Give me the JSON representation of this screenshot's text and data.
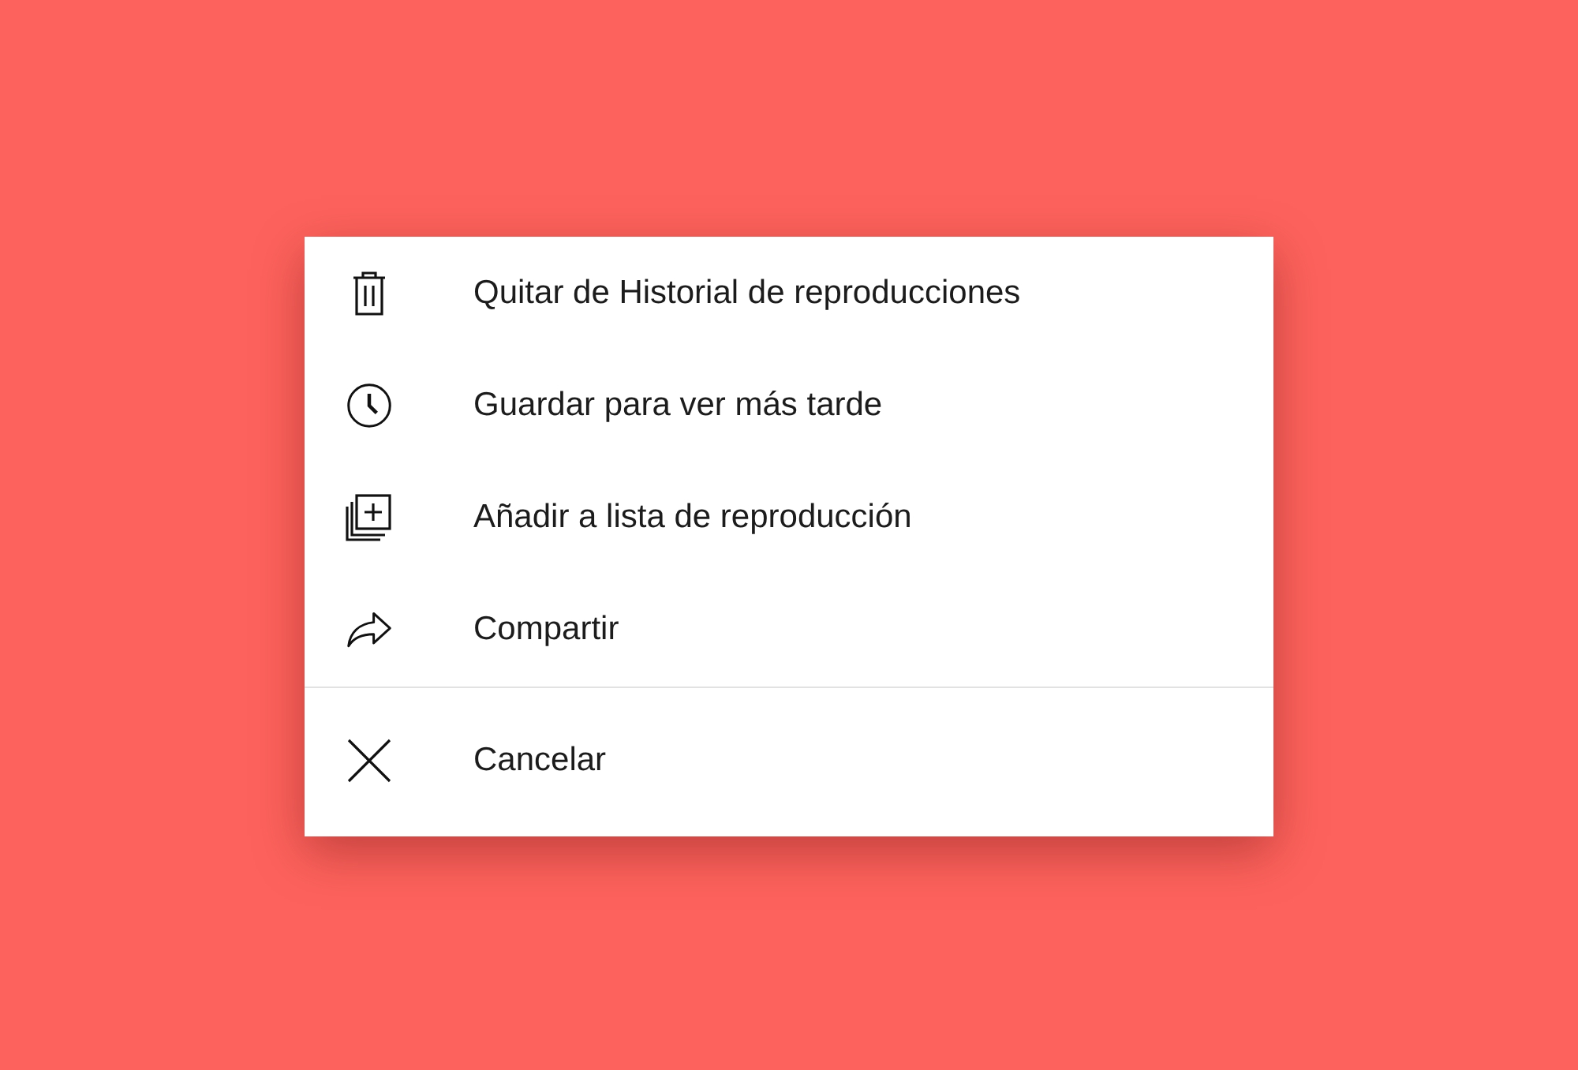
{
  "menu": {
    "items": [
      {
        "label": "Quitar de Historial de reproducciones"
      },
      {
        "label": "Guardar para ver más tarde"
      },
      {
        "label": "Añadir a lista de reproducción"
      },
      {
        "label": "Compartir"
      }
    ]
  },
  "cancel": {
    "label": "Cancelar"
  }
}
